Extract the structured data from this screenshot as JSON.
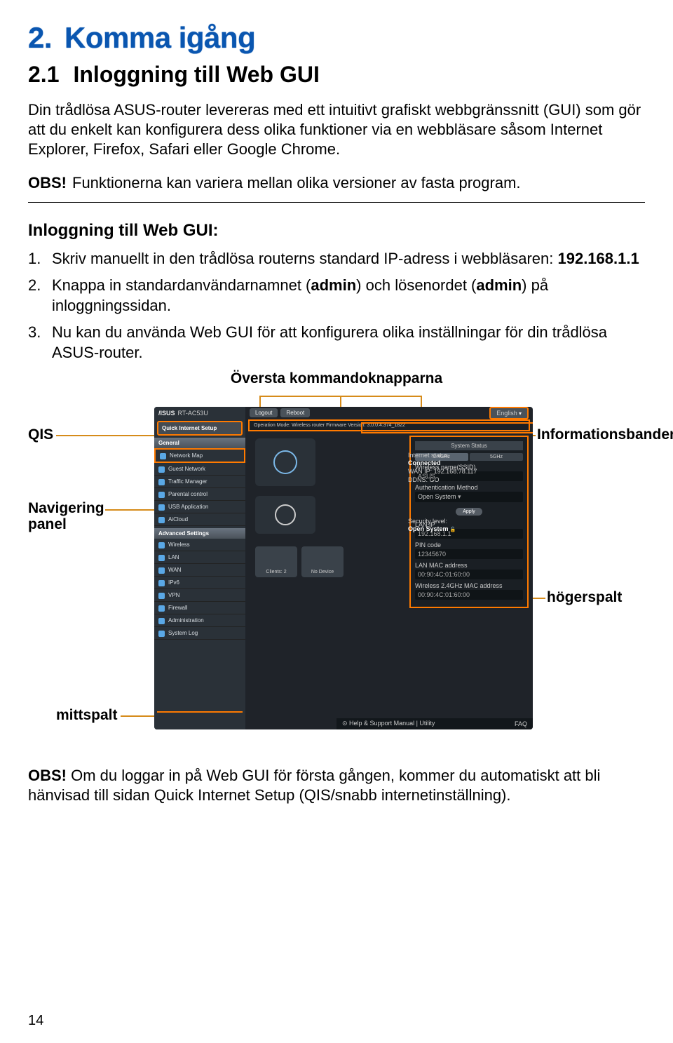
{
  "heading": {
    "num": "2.",
    "title": "Komma igång"
  },
  "subheading": {
    "num": "2.1",
    "title": "Inloggning till Web GUI"
  },
  "intro": "Din trådlösa ASUS-router levereras med ett intuitivt grafiskt webbgränssnitt (GUI) som gör att du enkelt kan konfigurera dess olika funktioner via en webbläsare såsom Internet Explorer, Firefox, Safari eller Google Chrome.",
  "obs1": {
    "label": "OBS!",
    "text": "Funktionerna kan variera mellan olika versioner av fasta program."
  },
  "steps_title": "Inloggning till Web GUI:",
  "steps": [
    {
      "n": "1.",
      "pre": "Skriv manuellt in den trådlösa routerns standard IP-adress i webbläsaren: ",
      "bold": "192.168.1.1"
    },
    {
      "n": "2.",
      "pre": "Knappa in standardanvändarnamnet (",
      "b1": "admin",
      "mid": ") och lösenordet (",
      "b2": "admin",
      "post": ") på inloggningssidan."
    },
    {
      "n": "3.",
      "pre": "Nu kan du använda Web GUI för att konfigurera olika inställningar för din trådlösa ASUS-router."
    }
  ],
  "caption": "Översta kommandoknapparna",
  "labels": {
    "qis": "QIS",
    "nav": "Navigering panel",
    "mitt": "mittspalt",
    "info": "Informationsbanderoll",
    "right": "högerspalt"
  },
  "router": {
    "model": "RT-AC53U",
    "logout": "Logout",
    "reboot": "Reboot",
    "lang": "English",
    "opmode": "Operation Mode: Wireless router   Firmware Version: 3.0.0.4.374_1822",
    "qis_label": "Quick Internet Setup",
    "gen": "General",
    "items_gen": [
      "Network Map",
      "Guest Network",
      "Traffic Manager",
      "Parental control",
      "USB Application",
      "AiCloud"
    ],
    "adv": "Advanced Settings",
    "items_adv": [
      "Wireless",
      "LAN",
      "WAN",
      "IPv6",
      "VPN",
      "Firewall",
      "Administration",
      "System Log"
    ],
    "status_title": "Internet status:",
    "status_val": "Connected",
    "wanip": "WAN IP: 192.168.78.117",
    "ddns": "DDNS: GO",
    "sec_title": "Security level:",
    "sec_val": "Open System",
    "clients": "Clients: 2",
    "nodev": "No Device",
    "panel_title": "System Status",
    "tab1": "2.4GHz",
    "tab2": "5GHz",
    "f1": "Wireless name(SSID)",
    "v1": "ASUS",
    "f2": "Authentication Method",
    "v2": "Open System",
    "apply": "Apply",
    "f3": "LAN IP",
    "v3": "192.168.1.1",
    "f4": "PIN code",
    "v4": "12345670",
    "f5": "LAN MAC address",
    "v5": "00:90:4C:01:60:00",
    "f6": "Wireless 2.4GHz MAC address",
    "v6": "00:90:4C:01:60:00",
    "help": "⊙ Help & Support  Manual | Utility",
    "faq": "FAQ"
  },
  "obs2": {
    "label": "OBS!",
    "text": "Om du loggar in på Web GUI för första gången, kommer du automatiskt att bli hänvisad till sidan Quick Internet Setup (QIS/snabb internetinställning)."
  },
  "pagenum": "14"
}
